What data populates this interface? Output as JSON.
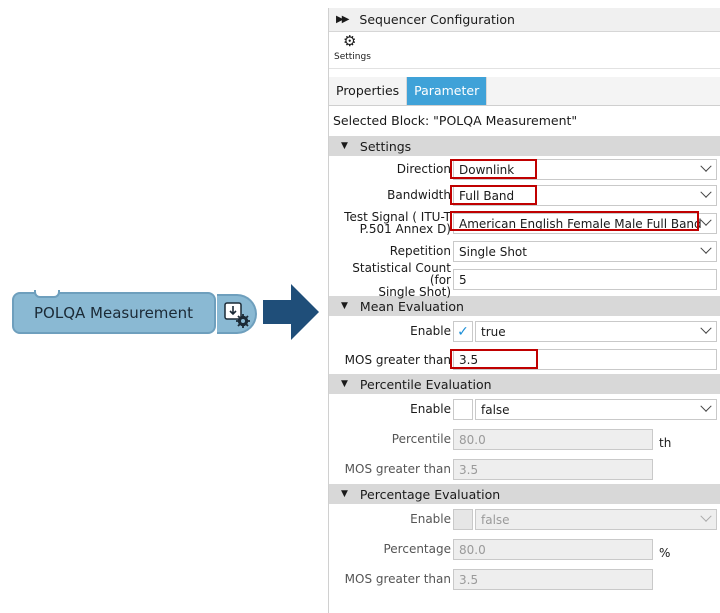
{
  "block": {
    "label": "POLQA Measurement",
    "icon": "download-settings-icon"
  },
  "panel": {
    "title": "Sequencer Configuration",
    "toolbar_settings_label": "Settings",
    "tabs": [
      {
        "label": "Properties",
        "active": false
      },
      {
        "label": "Parameter",
        "active": true
      }
    ],
    "selected_block": "Selected Block: \"POLQA Measurement\"",
    "sections": {
      "settings": {
        "title": "Settings",
        "direction_label": "Direction",
        "direction_value": "Downlink",
        "bandwidth_label": "Bandwidth",
        "bandwidth_value": "Full Band",
        "test_signal_label_1": "Test Signal ( ITU-T",
        "test_signal_label_2": "P.501 Annex D)",
        "test_signal_value": "American English Female Male Full Band",
        "repetition_label": "Repetition",
        "repetition_value": "Single Shot",
        "stat_count_label_1": "Statistical Count (for",
        "stat_count_label_2": "Single Shot)",
        "stat_count_value": "5"
      },
      "mean": {
        "title": "Mean Evaluation",
        "enable_label": "Enable",
        "enable_checked": true,
        "enable_value": "true",
        "mos_label": "MOS greater than",
        "mos_value": "3.5"
      },
      "percentile": {
        "title": "Percentile Evaluation",
        "enable_label": "Enable",
        "enable_checked": false,
        "enable_value": "false",
        "percentile_label": "Percentile",
        "percentile_value": "80.0",
        "percentile_unit": "th",
        "mos_label": "MOS greater than",
        "mos_value": "3.5"
      },
      "percentage": {
        "title": "Percentage Evaluation",
        "enable_label": "Enable",
        "enable_checked": false,
        "enable_value": "false",
        "percentage_label": "Percentage",
        "percentage_value": "80.0",
        "percentage_unit": "%",
        "mos_label": "MOS greater than",
        "mos_value": "3.5"
      }
    }
  },
  "colors": {
    "accent": "#3fa2d8",
    "highlight": "#c00000",
    "block_fill": "#8ab9d3",
    "arrow": "#1f4e79"
  }
}
